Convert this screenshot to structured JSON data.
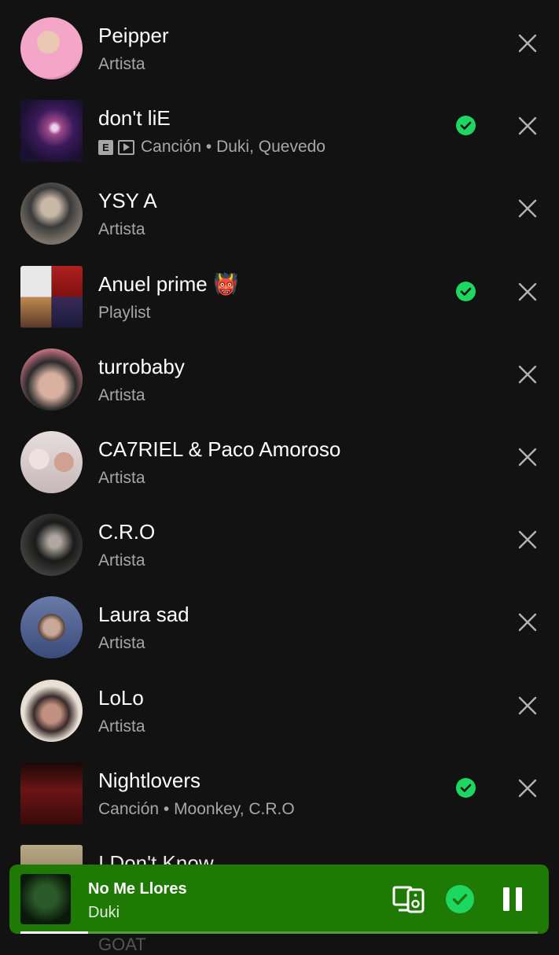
{
  "items": [
    {
      "title": "Peipper",
      "subtitle": "Artista",
      "shape": "round",
      "added": false,
      "thumb_colors": [
        "#f4a6c8",
        "#d9b5a0"
      ]
    },
    {
      "title": "don't liE",
      "subtitle": "Canción • Duki, Quevedo",
      "explicit_badge": "E",
      "video_badge": true,
      "shape": "square",
      "added": true,
      "thumb_colors": [
        "#2a1a40",
        "#8a3a5a"
      ]
    },
    {
      "title": "YSY A",
      "subtitle": "Artista",
      "shape": "round",
      "added": false,
      "thumb_colors": [
        "#5a5550",
        "#2a2a2a"
      ]
    },
    {
      "title": "Anuel prime 👹",
      "subtitle": "Playlist",
      "shape": "square",
      "added": true,
      "thumb_colors": [
        "#b02020",
        "#3a2a4a"
      ]
    },
    {
      "title": "turrobaby",
      "subtitle": "Artista",
      "shape": "round",
      "added": false,
      "thumb_colors": [
        "#c08080",
        "#303030"
      ]
    },
    {
      "title": "CA7RIEL & Paco Amoroso",
      "subtitle": "Artista",
      "shape": "round",
      "added": false,
      "thumb_colors": [
        "#e0d0d0",
        "#8a6a6a"
      ]
    },
    {
      "title": "C.R.O",
      "subtitle": "Artista",
      "shape": "round",
      "added": false,
      "thumb_colors": [
        "#2a2a2a",
        "#505050"
      ]
    },
    {
      "title": "Laura sad",
      "subtitle": "Artista",
      "shape": "round",
      "added": false,
      "thumb_colors": [
        "#5a6a9a",
        "#b09080"
      ]
    },
    {
      "title": "LoLo",
      "subtitle": "Artista",
      "shape": "round",
      "added": false,
      "thumb_colors": [
        "#e0d8c8",
        "#6a5040"
      ]
    },
    {
      "title": "Nightlovers",
      "subtitle": "Canción • Moonkey, C.R.O",
      "shape": "square",
      "added": true,
      "thumb_colors": [
        "#5a1010",
        "#200808"
      ]
    },
    {
      "title": "I Don't Know",
      "partial": true,
      "shape": "square",
      "thumb_colors": [
        "#b0a080",
        "#806040"
      ]
    }
  ],
  "player": {
    "title": "No Me Llores",
    "artist": "Duki",
    "progress": 0.13,
    "accent": "#1f7a05",
    "icons": [
      "connect-device-icon",
      "added-check-icon",
      "pause-icon"
    ]
  },
  "below_player_text": "GOAT",
  "colors": {
    "background": "#121212",
    "green": "#1ed760",
    "muted": "#a7a7a7"
  }
}
